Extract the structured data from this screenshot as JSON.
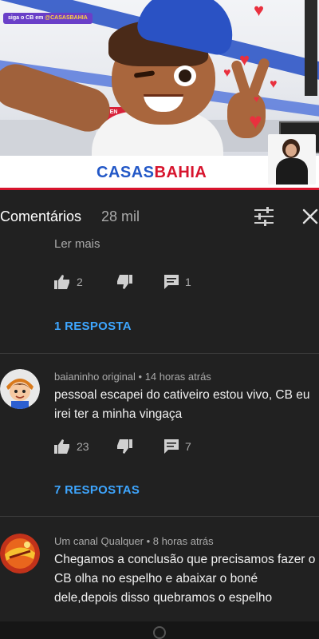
{
  "video": {
    "follow_badge_prefix": "siga o CB em ",
    "follow_badge_handle": "@CASASBAHIA",
    "red_sign_text": "VEN"
  },
  "banner": {
    "logo_part1": "CASAS",
    "logo_part2": "BAHIA"
  },
  "colors": {
    "accent_link": "#3ea6ff",
    "background": "#212121",
    "brand_blue": "#2358c7",
    "brand_red": "#d7142d"
  },
  "comments_panel": {
    "title": "Comentários",
    "count": "28 mil",
    "filter_icon": "sort-filter-icon",
    "close_icon": "close-icon"
  },
  "thread_top": {
    "read_more": "Ler mais",
    "likes": "2",
    "replies_count": "1",
    "replies_link": "1 RESPOSTA"
  },
  "comments": [
    {
      "author": "baianinho original",
      "time": "14 horas atrás",
      "text": "pessoal escapei do cativeiro estou vivo, CB eu irei ter a minha vingaça",
      "likes": "23",
      "replies_count": "7",
      "replies_link": "7 RESPOSTAS"
    },
    {
      "author": "Um canal Qualquer",
      "time": "8 horas atrás",
      "text": "Chegamos a conclusão que precisamos fazer o CB olha no espelho e abaixar o boné dele,depois disso quebramos o espelho"
    }
  ]
}
